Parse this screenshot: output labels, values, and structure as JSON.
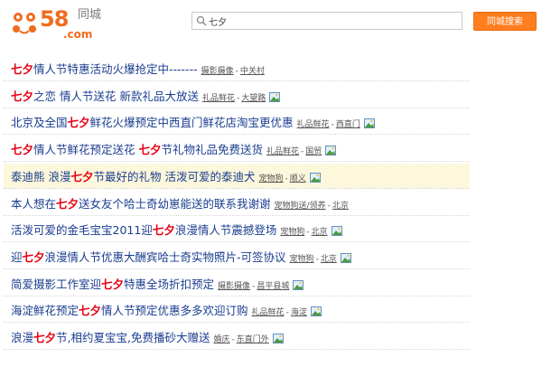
{
  "header": {
    "logo_58": "58",
    "logo_com": ".com",
    "logo_city": "同城",
    "search_value": "七夕",
    "search_button": "同城搜索"
  },
  "results": [
    {
      "pre": "",
      "kw": "七夕",
      "post": "情人节特惠活动火爆抢定中-------",
      "kw2": "",
      "post2": "",
      "category": "摄影摄像",
      "location": "中关村",
      "img": false
    },
    {
      "pre": "",
      "kw": "七夕",
      "post": "之恋 情人节送花 新款礼品大放送",
      "kw2": "",
      "post2": "",
      "category": "礼品鲜花",
      "location": "大望路",
      "img": true
    },
    {
      "pre": "北京及全国",
      "kw": "七夕",
      "post": "鲜花火爆预定中西直门鲜花店淘宝更优惠",
      "kw2": "",
      "post2": "",
      "category": "礼品鲜花",
      "location": "西直门",
      "img": true
    },
    {
      "pre": "",
      "kw": "七夕",
      "post": "情人节鲜花预定送花 ",
      "kw2": "七夕",
      "post2": "节礼物礼品免费送货",
      "category": "礼品鲜花",
      "location": "国贸",
      "img": true
    },
    {
      "pre": "泰迪熊 浪漫",
      "kw": "七夕",
      "post": "节最好的礼物 活泼可爱的泰迪犬",
      "kw2": "",
      "post2": "",
      "category": "宠物狗",
      "location": "顺义",
      "img": true,
      "highlight": true
    },
    {
      "pre": "本人想在",
      "kw": "七夕",
      "post": "送女友个哈士奇幼崽能送的联系我谢谢",
      "kw2": "",
      "post2": "",
      "category": "宠物狗送/领养",
      "location": "北京",
      "img": false
    },
    {
      "pre": "活泼可爱的金毛宝宝2011迎",
      "kw": "七夕",
      "post": "浪漫情人节震撼登场",
      "kw2": "",
      "post2": "",
      "category": "宠物狗",
      "location": "北京",
      "img": true
    },
    {
      "pre": "迎",
      "kw": "七夕",
      "post": "浪漫情人节优惠大酬宾哈士奇实物照片-可签协议",
      "kw2": "",
      "post2": "",
      "category": "宠物狗",
      "location": "北京",
      "img": true
    },
    {
      "pre": "简爱摄影工作室迎",
      "kw": "七夕",
      "post": "特惠全场折扣预定",
      "kw2": "",
      "post2": "",
      "category": "摄影摄像",
      "location": "昌平县城",
      "img": true
    },
    {
      "pre": "海淀鲜花预定",
      "kw": "七夕",
      "post": "情人节预定优惠多多欢迎订购",
      "kw2": "",
      "post2": "",
      "category": "礼品鲜花",
      "location": "海淀",
      "img": true
    },
    {
      "pre": "浪漫",
      "kw": "七夕",
      "post": "节,相约夏宝宝,免费播砂大赠送",
      "kw2": "",
      "post2": "",
      "category": "婚庆",
      "location": "东直门外",
      "img": true
    }
  ]
}
